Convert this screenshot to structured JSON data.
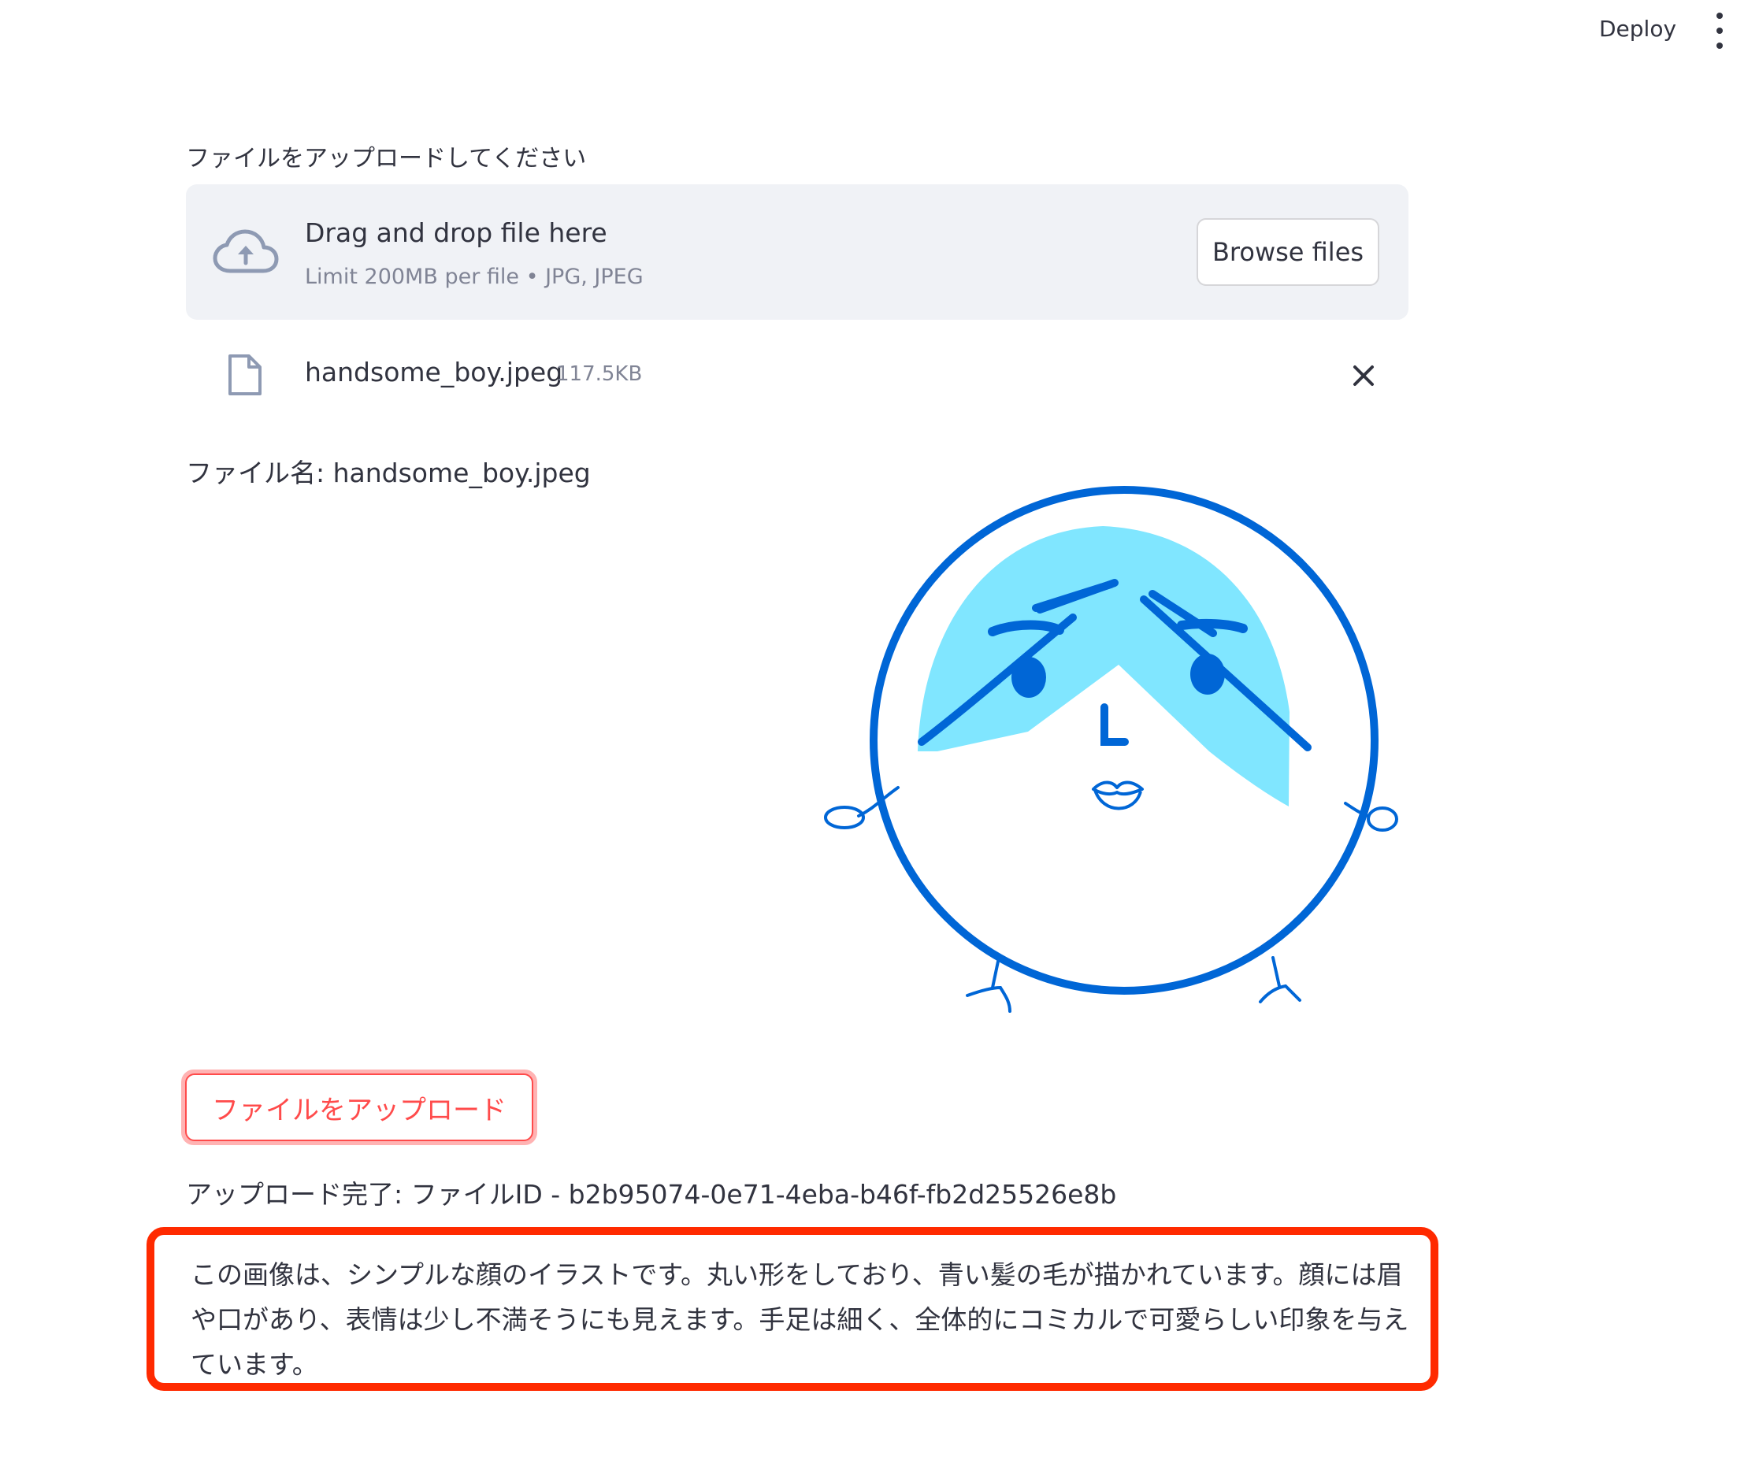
{
  "header": {
    "deploy_label": "Deploy",
    "menu_icon": "kebab-menu-icon"
  },
  "uploader": {
    "label": "ファイルをアップロードしてください",
    "drop_title": "Drag and drop file here",
    "drop_subtitle": "Limit 200MB per file • JPG, JPEG",
    "browse_label": "Browse files",
    "cloud_icon": "cloud-upload-icon"
  },
  "uploaded_file": {
    "name": "handsome_boy.jpeg",
    "size": "117.5KB",
    "file_icon": "file-icon",
    "remove_icon": "close-icon"
  },
  "file_name_line": "ファイル名: handsome_boy.jpeg",
  "upload_button_label": "ファイルをアップロード",
  "complete_line": "アップロード完了: ファイルID - b2b95074-0e71-4eba-b46f-fb2d25526e8b",
  "description": "この画像は、シンプルな顔のイラストです。丸い形をしており、青い髪の毛が描かれています。顔には眉や口があり、表情は少し不満そうにも見えます。手足は細く、全体的にコミカルで可愛らしい印象を与えています。",
  "colors": {
    "accent": "#ff4b4b",
    "highlight_border": "#ff2a00",
    "illustration_line": "#0066d6",
    "illustration_hair": "#80e6ff"
  }
}
